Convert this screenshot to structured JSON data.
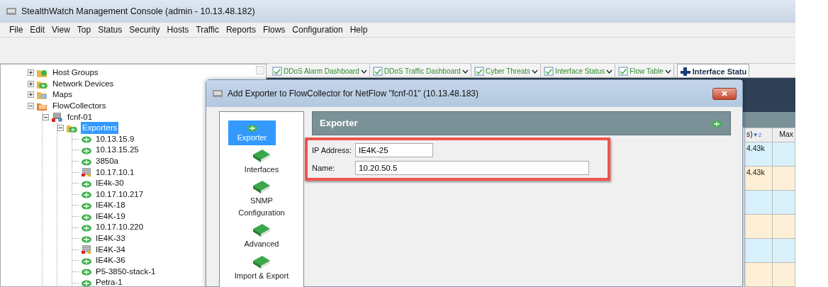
{
  "window": {
    "title": "StealthWatch Management Console (admin - 10.13.48.182)"
  },
  "menu": [
    "File",
    "Edit",
    "View",
    "Top",
    "Status",
    "Security",
    "Hosts",
    "Traffic",
    "Reports",
    "Flows",
    "Configuration",
    "Help"
  ],
  "tree": [
    {
      "label": "Host Groups",
      "kind": "group",
      "expanded": false,
      "selected": false
    },
    {
      "label": "Network Devices",
      "kind": "router-folder",
      "expanded": false,
      "selected": false
    },
    {
      "label": "Maps",
      "kind": "folder",
      "expanded": false,
      "selected": false
    },
    {
      "label": "FlowCollectors",
      "kind": "orange-folder",
      "expanded": true,
      "selected": false,
      "children": [
        {
          "label": "fcnf-01",
          "kind": "server",
          "expanded": true,
          "selected": false,
          "children": [
            {
              "label": "Exporters",
              "kind": "router-folder",
              "expanded": true,
              "selected": true,
              "children": [
                {
                  "label": "10.13.15.9",
                  "kind": "router",
                  "selected": false
                },
                {
                  "label": "10.13.15.25",
                  "kind": "router",
                  "selected": false
                },
                {
                  "label": "3850a",
                  "kind": "router",
                  "selected": false
                },
                {
                  "label": "10.17.10.1",
                  "kind": "device",
                  "selected": false
                },
                {
                  "label": "IE4k-30",
                  "kind": "router",
                  "selected": false
                },
                {
                  "label": "10.17.10.217",
                  "kind": "router",
                  "selected": false
                },
                {
                  "label": "IE4K-18",
                  "kind": "router",
                  "selected": false
                },
                {
                  "label": "IE4K-19",
                  "kind": "router",
                  "selected": false
                },
                {
                  "label": "10.17.10.220",
                  "kind": "router",
                  "selected": false
                },
                {
                  "label": "IE4K-33",
                  "kind": "router",
                  "selected": false
                },
                {
                  "label": "IE4K-34",
                  "kind": "device",
                  "selected": false
                },
                {
                  "label": "IE4K-36",
                  "kind": "router",
                  "selected": false
                },
                {
                  "label": "P5-3850-stack-1",
                  "kind": "router",
                  "selected": false
                },
                {
                  "label": "Petra-1",
                  "kind": "router",
                  "selected": false
                }
              ]
            }
          ]
        }
      ]
    }
  ],
  "tabs": [
    {
      "label": "DDoS Alarm Dashboard",
      "selected": false
    },
    {
      "label": "DDoS Traffic Dashboard",
      "selected": false
    },
    {
      "label": "Cyber Threats",
      "selected": false
    },
    {
      "label": "Interface Status",
      "selected": false
    },
    {
      "label": "Flow Table",
      "selected": false
    },
    {
      "label": "Interface Statu",
      "selected": true
    }
  ],
  "table": {
    "columns": [
      "s)",
      "Max"
    ],
    "sort_mark": "▼2",
    "rows": [
      [
        "4.43k",
        ""
      ],
      [
        "4.43k",
        ""
      ],
      [
        "",
        ""
      ],
      [
        "",
        ""
      ],
      [
        "",
        ""
      ],
      [
        "",
        ""
      ]
    ]
  },
  "dialog": {
    "title": "Add Exporter to FlowCollector for NetFlow \"fcnf-01\" (10.13.48.183)",
    "nav": [
      {
        "label": "Exporter",
        "kind": "router",
        "selected": true
      },
      {
        "label": "Interfaces",
        "kind": "book",
        "selected": false
      },
      {
        "label": "SNMP Configuration",
        "kind": "book",
        "selected": false
      },
      {
        "label": "Advanced",
        "kind": "book",
        "selected": false
      },
      {
        "label": "Import & Export",
        "kind": "book",
        "selected": false
      }
    ],
    "section_title": "Exporter",
    "fields": [
      {
        "label": "IP Address:",
        "value": "IE4K-25"
      },
      {
        "label": "Name:",
        "value": "10.20.50.5"
      }
    ]
  }
}
